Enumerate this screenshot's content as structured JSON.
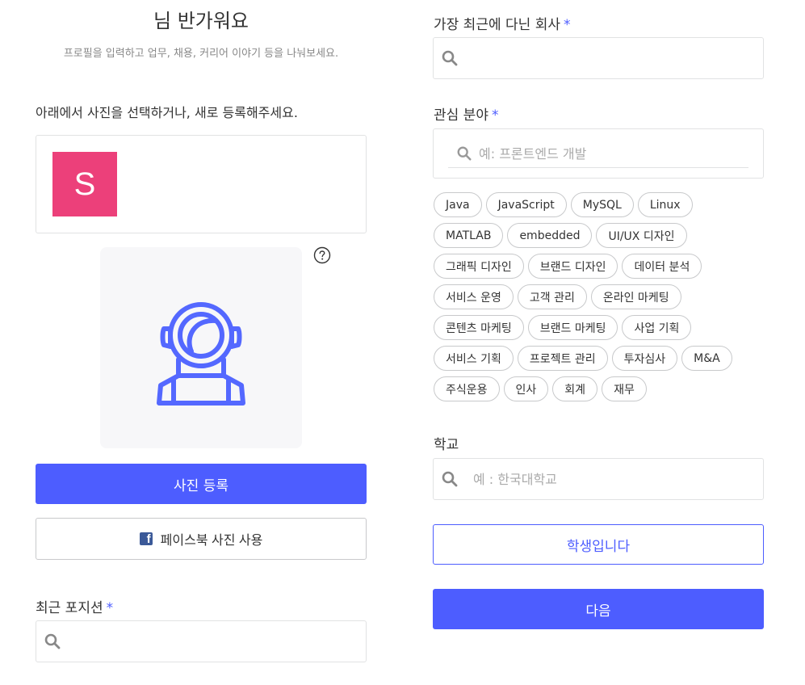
{
  "header": {
    "title": "님 반가워요",
    "subtitle": "프로필을 입력하고 업무, 채용, 커리어 이야기 등을 나눠보세요."
  },
  "photo": {
    "instruction": "아래에서 사진을 선택하거나, 새로 등록해주세요.",
    "avatar_letter": "S",
    "avatar_color": "#ec407a",
    "help_icon": "question-circle-icon",
    "illustration": "astronaut-icon",
    "upload_button": "사진 등록",
    "facebook_button": "페이스북 사진 사용",
    "facebook_icon": "facebook-icon",
    "facebook_glyph": "f"
  },
  "position": {
    "label": "최근 포지션",
    "required_mark": "*",
    "value": "",
    "placeholder": ""
  },
  "company": {
    "label": "가장 최근에 다닌 회사",
    "required_mark": "*",
    "value": "",
    "placeholder": ""
  },
  "interest": {
    "label": "관심 분야",
    "required_mark": "*",
    "placeholder": "예: 프론트엔드 개발",
    "tags": [
      "Java",
      "JavaScript",
      "MySQL",
      "Linux",
      "MATLAB",
      "embedded",
      "UI/UX 디자인",
      "그래픽 디자인",
      "브랜드 디자인",
      "데이터 분석",
      "서비스 운영",
      "고객 관리",
      "온라인 마케팅",
      "콘텐츠 마케팅",
      "브랜드 마케팅",
      "사업 기획",
      "서비스 기획",
      "프로젝트 관리",
      "투자심사",
      "M&A",
      "주식운용",
      "인사",
      "회계",
      "재무"
    ]
  },
  "school": {
    "label": "학교",
    "placeholder": "예 : 한국대학교",
    "student_button": "학생입니다"
  },
  "next_button": "다음",
  "colors": {
    "accent": "#4d5dff",
    "border": "#e1e2e3",
    "facebook": "#3b5998"
  }
}
